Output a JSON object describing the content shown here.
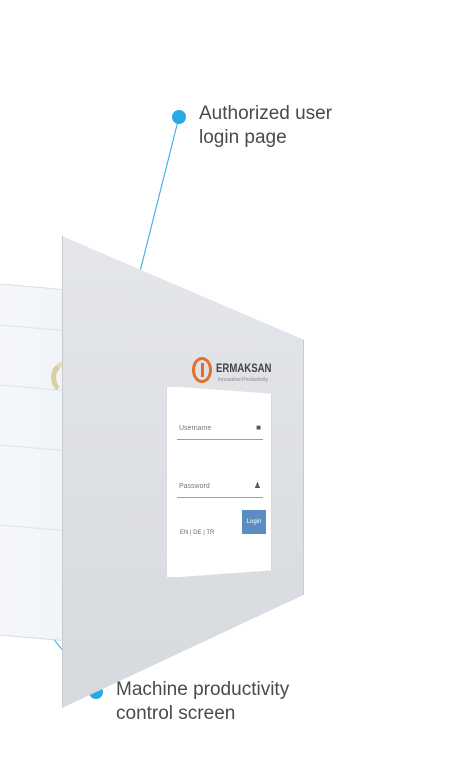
{
  "callouts": {
    "login": {
      "line1": "Authorized user",
      "line2": "login page"
    },
    "productivity": {
      "line1": "Machine productivity",
      "line2": "control screen"
    }
  },
  "colors": {
    "accent_line": "#29a9e1",
    "logo_orange": "#e0712a",
    "login_button": "#5a8ec2"
  },
  "login_page": {
    "brand": "ERMAKSAN",
    "brand_subtitle": "Innovative Productivity",
    "username_placeholder": "Username",
    "password_placeholder": "Password",
    "username_icon": "lock-icon",
    "password_icon": "user-icon",
    "login_label": "Login",
    "languages": "EN | DE | TR"
  }
}
